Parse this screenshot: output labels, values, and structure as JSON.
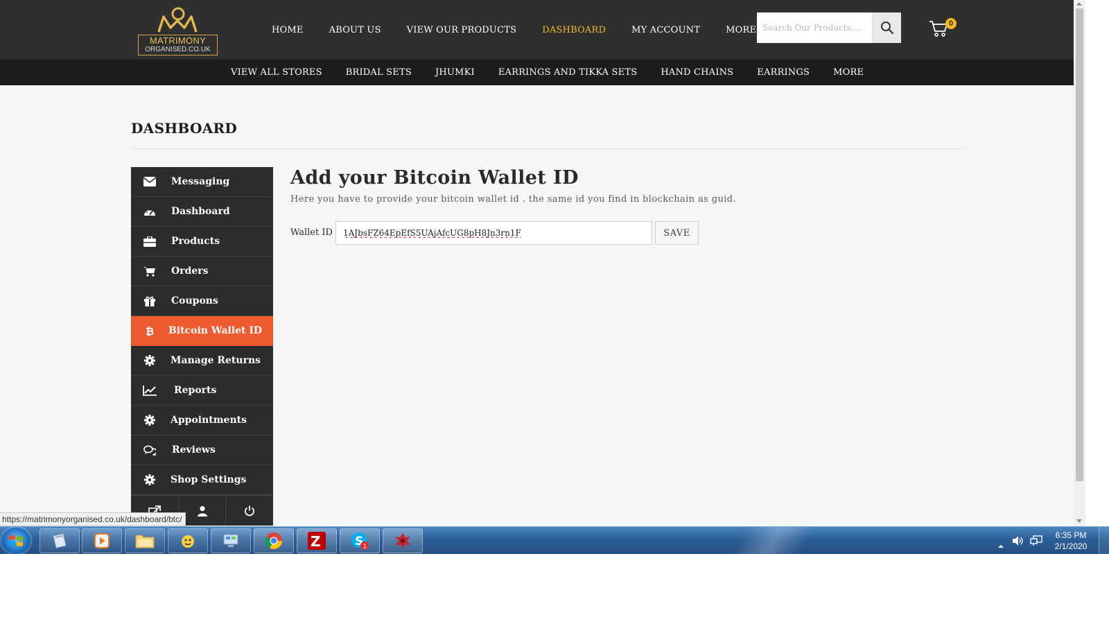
{
  "brand": {
    "line1": "MATRIMONY",
    "line2": "ORGANISED.CO.UK"
  },
  "main_nav": [
    {
      "label": "HOME"
    },
    {
      "label": "ABOUT US"
    },
    {
      "label": "VIEW OUR PRODUCTS"
    },
    {
      "label": "DASHBOARD",
      "active": true
    },
    {
      "label": "MY ACCOUNT"
    },
    {
      "label": "MORE"
    }
  ],
  "search": {
    "placeholder": "Search Our Products....",
    "value": ""
  },
  "cart": {
    "count": "0"
  },
  "category_nav": [
    {
      "label": "VIEW ALL STORES"
    },
    {
      "label": "BRIDAL SETS"
    },
    {
      "label": "JHUMKI"
    },
    {
      "label": "EARRINGS AND TIKKA SETS"
    },
    {
      "label": "HAND CHAINS"
    },
    {
      "label": "EARRINGS"
    },
    {
      "label": "MORE"
    }
  ],
  "page": {
    "title": "DASHBOARD"
  },
  "sidebar": {
    "items": [
      {
        "label": "Messaging",
        "icon": "envelope-icon"
      },
      {
        "label": "Dashboard",
        "icon": "dashboard-gauge-icon"
      },
      {
        "label": "Products",
        "icon": "briefcase-icon"
      },
      {
        "label": "Orders",
        "icon": "cart-icon"
      },
      {
        "label": "Coupons",
        "icon": "gift-icon"
      },
      {
        "label": "Bitcoin Wallet ID",
        "icon": "bitcoin-icon",
        "active": true
      },
      {
        "label": "Manage Returns",
        "icon": "gear-icon"
      },
      {
        "label": "Reports",
        "icon": "line-chart-icon"
      },
      {
        "label": "Appointments",
        "icon": "gear-icon"
      },
      {
        "label": "Reviews",
        "icon": "comments-icon"
      },
      {
        "label": "Shop Settings",
        "icon": "gear-icon"
      }
    ],
    "footer_icons": [
      "external-link-icon",
      "user-icon",
      "power-icon"
    ]
  },
  "wallet": {
    "heading": "Add your Bitcoin Wallet ID",
    "description": "Here you have to provide your bitcoin wallet id . the same id you find in blockchain as guid.",
    "label": "Wallet ID",
    "value": "1AJbsFZ64EpEfS5UAjAfcUG8pH8Jn3rn1F",
    "save_label": "SAVE"
  },
  "status_url": "https://matrimonyorganised.co.uk/dashboard/btc/",
  "taskbar": {
    "apps": [
      "windows-explorer-icon",
      "media-player-icon",
      "folder-icon",
      "messenger-icon",
      "control-panel-icon",
      "chrome-icon",
      "filezilla-icon",
      "skype-icon",
      "app-icon"
    ],
    "skype_badge": "1",
    "time": "6:35 PM",
    "date": "2/1/2020"
  },
  "colors": {
    "header_bg": "#2f2f2f",
    "category_bg": "#1d1d1d",
    "active_nav": "#f3b91e",
    "sidebar_bg": "#2c2c2c",
    "sidebar_active": "#ee5a2f",
    "content_bg": "#f6f6f6"
  }
}
